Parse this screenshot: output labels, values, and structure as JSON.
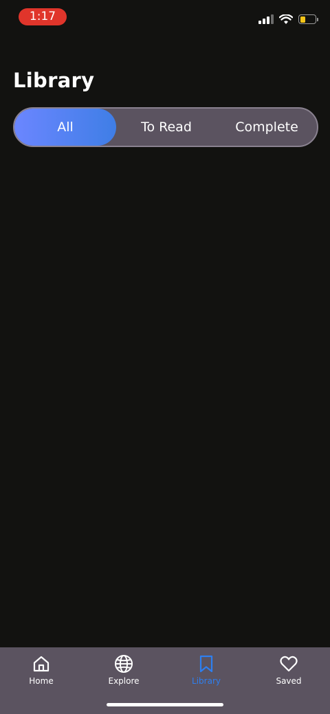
{
  "status_bar": {
    "time": "1:17"
  },
  "header": {
    "title": "Library"
  },
  "filter": {
    "segments": [
      {
        "label": "All",
        "selected": true
      },
      {
        "label": "To Read",
        "selected": false
      },
      {
        "label": "Complete",
        "selected": false
      }
    ]
  },
  "tab_bar": {
    "items": [
      {
        "label": "Home",
        "icon": "home-icon"
      },
      {
        "label": "Explore",
        "icon": "globe-icon"
      },
      {
        "label": "Library",
        "icon": "bookmark-icon",
        "active": true
      },
      {
        "label": "Saved",
        "icon": "heart-icon"
      }
    ]
  },
  "colors": {
    "background": "#121210",
    "tab_bar": "#5b5360",
    "accent": "#2e7ff0",
    "time_pill": "#e0352b",
    "segment_active_start": "#6b86ff",
    "segment_active_end": "#3f7ee6"
  }
}
